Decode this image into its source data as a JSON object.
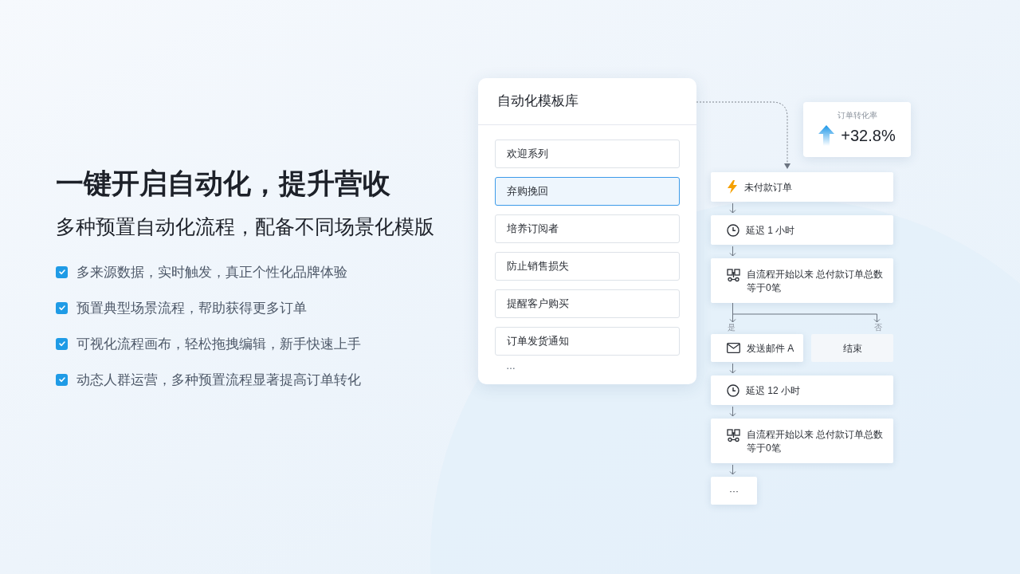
{
  "hero": {
    "title": "一键开启自动化，提升营收",
    "subtitle": "多种预置自动化流程，配备不同场景化模版",
    "features": [
      {
        "text": "多来源数据，实时触发，真正个性化品牌体验",
        "checked": true
      },
      {
        "text": "预置典型场景流程，帮助获得更多订单",
        "checked": true
      },
      {
        "text": "可视化流程画布，轻松拖拽编辑，新手快速上手",
        "checked": true
      },
      {
        "text": "动态人群运营，多种预置流程显著提高订单转化",
        "checked": true
      }
    ]
  },
  "template_library": {
    "title": "自动化模板库",
    "items": [
      {
        "label": "欢迎系列",
        "selected": false
      },
      {
        "label": "弃购挽回",
        "selected": true
      },
      {
        "label": "培养订阅者",
        "selected": false
      },
      {
        "label": "防止销售损失",
        "selected": false
      },
      {
        "label": "提醒客户购买",
        "selected": false
      },
      {
        "label": "订单发货通知",
        "selected": false
      }
    ],
    "more": "…"
  },
  "stat": {
    "label": "订单转化率",
    "value": "+32.8%"
  },
  "flow": {
    "steps": [
      {
        "kind": "trigger",
        "text": "未付款订单"
      },
      {
        "kind": "delay",
        "text": "延迟 1 小时"
      },
      {
        "kind": "condition",
        "text": "自流程开始以来 总付款订单总数等于0笔"
      },
      {
        "kind": "branch",
        "yes_label": "是",
        "no_label": "否",
        "yes": {
          "kind": "email",
          "text": "发送邮件 A"
        },
        "no": {
          "kind": "end",
          "text": "结束"
        }
      },
      {
        "kind": "delay",
        "text": "延迟 12 小时"
      },
      {
        "kind": "condition",
        "text": "自流程开始以来 总付款订单总数等于0笔"
      },
      {
        "kind": "more",
        "text": "···"
      }
    ]
  }
}
